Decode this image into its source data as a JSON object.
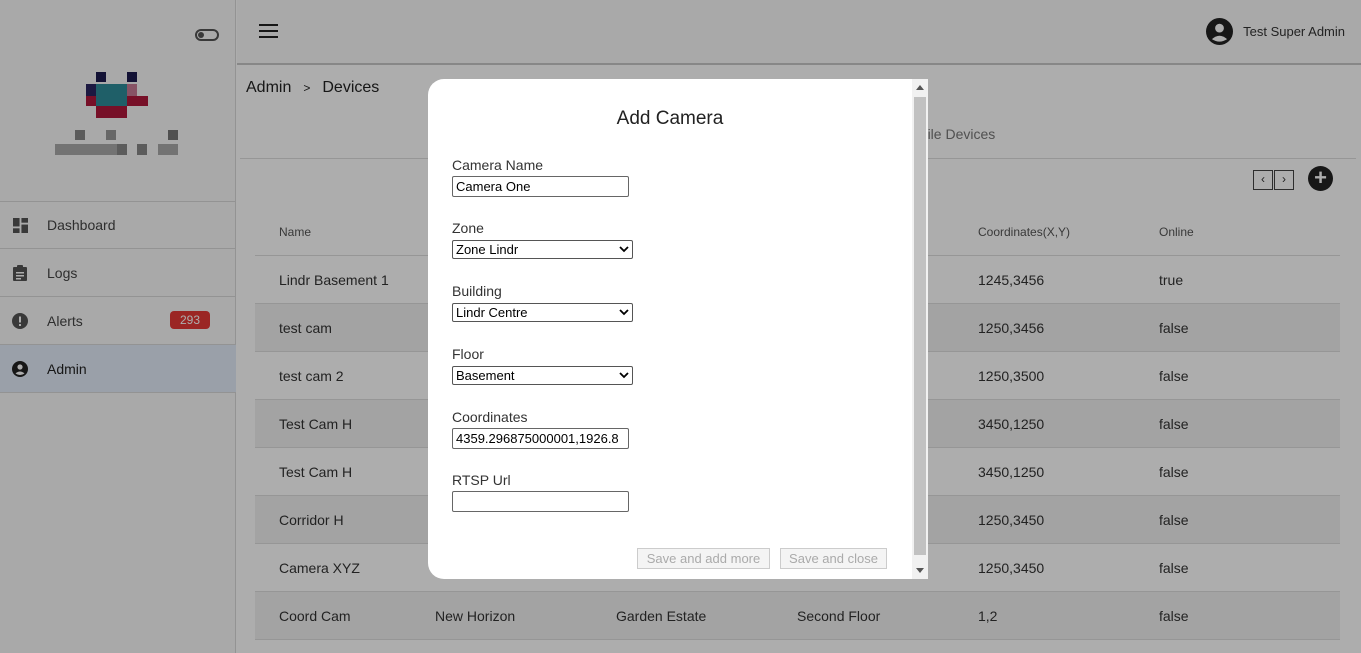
{
  "user": {
    "name": "Test Super Admin"
  },
  "sidebar": {
    "items": [
      {
        "label": "Dashboard",
        "icon": "dashboard-icon"
      },
      {
        "label": "Logs",
        "icon": "clipboard-icon"
      },
      {
        "label": "Alerts",
        "icon": "alert-icon",
        "badge": "293"
      },
      {
        "label": "Admin",
        "icon": "account-icon"
      }
    ]
  },
  "breadcrumb": {
    "root": "Admin",
    "sep": ">",
    "current": "Devices"
  },
  "tabs": {
    "mobile": "obile Devices"
  },
  "pager": {
    "prev": "‹",
    "next": "›"
  },
  "add_button": "+",
  "table": {
    "headers": [
      "Name",
      "",
      "",
      "",
      "Coordinates(X,Y)",
      "Online"
    ],
    "rows": [
      [
        "Lindr Basement 1",
        "",
        "",
        "",
        "1245,3456",
        "true"
      ],
      [
        "test cam",
        "",
        "",
        "",
        "1250,3456",
        "false"
      ],
      [
        "test cam 2",
        "",
        "",
        "",
        "1250,3500",
        "false"
      ],
      [
        "Test Cam H",
        "",
        "",
        "",
        "3450,1250",
        "false"
      ],
      [
        "Test Cam H",
        "",
        "",
        "",
        "3450,1250",
        "false"
      ],
      [
        "Corridor H",
        "",
        "",
        "",
        "1250,3450",
        "false"
      ],
      [
        "Camera XYZ",
        "",
        "",
        "",
        "1250,3450",
        "false"
      ],
      [
        "Coord Cam",
        "New Horizon",
        "Garden Estate",
        "Second Floor",
        "1,2",
        "false"
      ]
    ]
  },
  "modal": {
    "title": "Add Camera",
    "camera_name_label": "Camera Name",
    "camera_name_value": "Camera One",
    "zone_label": "Zone",
    "zone_value": "Zone Lindr",
    "building_label": "Building",
    "building_value": "Lindr Centre",
    "floor_label": "Floor",
    "floor_value": "Basement",
    "coordinates_label": "Coordinates",
    "coordinates_value": "4359.296875000001,1926.8",
    "rtsp_label": "RTSP Url",
    "rtsp_value": "",
    "save_more": "Save and add more",
    "save_close": "Save and close"
  }
}
